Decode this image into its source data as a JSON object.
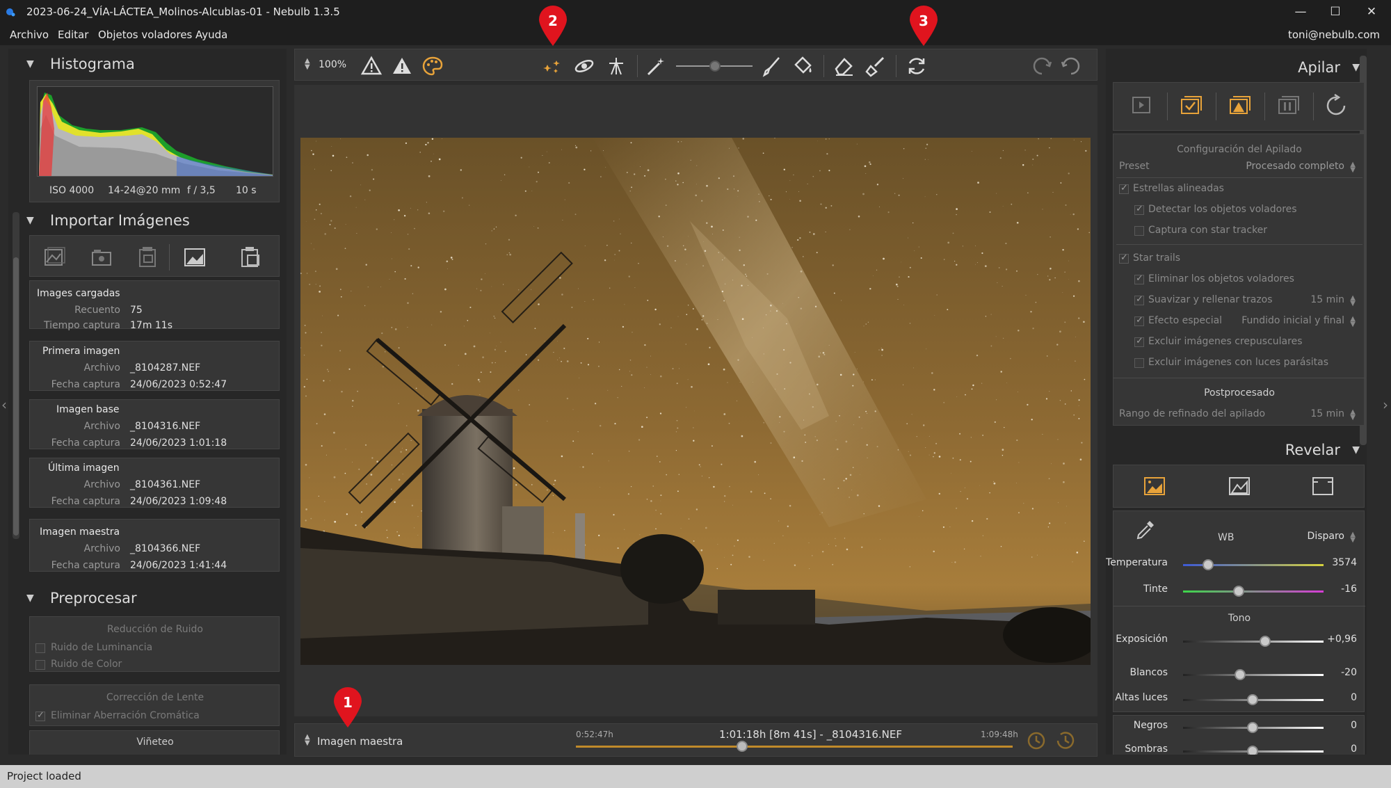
{
  "window": {
    "title": "2023-06-24_VÍA-LÁCTEA_Molinos-Alcublas-01 - Nebulb 1.3.5",
    "minimize": "—",
    "maximize": "☐",
    "close": "✕"
  },
  "menu": {
    "items": [
      "Archivo",
      "Editar",
      "Objetos voladores",
      "Ayuda"
    ],
    "user": "toni@nebulb.com"
  },
  "left": {
    "histogram": {
      "title": "Histograma",
      "iso": "ISO 4000",
      "lens": "14-24@20 mm",
      "aperture": "f / 3,5",
      "exposure": "10 s"
    },
    "import": {
      "title": "Importar Imágenes",
      "loaded": {
        "label": "Images cargadas",
        "count_key": "Recuento",
        "count_val": "75",
        "time_key": "Tiempo captura",
        "time_val": "17m 11s"
      },
      "first": {
        "label": "Primera imagen",
        "file_key": "Archivo",
        "file_val": "_8104287.NEF",
        "date_key": "Fecha captura",
        "date_val": "24/06/2023 0:52:47"
      },
      "base": {
        "label": "Imagen base",
        "file_key": "Archivo",
        "file_val": "_8104316.NEF",
        "date_key": "Fecha captura",
        "date_val": "24/06/2023 1:01:18"
      },
      "last": {
        "label": "Última imagen",
        "file_key": "Archivo",
        "file_val": "_8104361.NEF",
        "date_key": "Fecha captura",
        "date_val": "24/06/2023 1:09:48"
      },
      "master": {
        "label": "Imagen maestra",
        "file_key": "Archivo",
        "file_val": "_8104366.NEF",
        "date_key": "Fecha captura",
        "date_val": "24/06/2023 1:41:44"
      }
    },
    "preprocess": {
      "title": "Preprocesar",
      "noise_title": "Reducción de Ruido",
      "luminance": "Ruido de Luminancia",
      "color": "Ruido de Color",
      "lens_title": "Corrección de Lente",
      "chromatic": "Eliminar Aberración Cromática",
      "vignette": "Viñeteo"
    }
  },
  "toolbar": {
    "zoom": "100%"
  },
  "timeline": {
    "label": "Imagen maestra",
    "start": "0:52:47h",
    "center": "1:01:18h [8m 41s] - _8104316.NEF",
    "end": "1:09:48h",
    "position": 0.38
  },
  "markers": {
    "m1": "1",
    "m2": "2",
    "m3": "3"
  },
  "right": {
    "stack": {
      "title": "Apilar",
      "config_title": "Configuración del Apilado",
      "preset_key": "Preset",
      "preset_val": "Procesado completo",
      "aligned": "Estrellas alineadas",
      "detect": "Detectar los objetos voladores",
      "tracker": "Captura con star tracker",
      "trails": "Star trails",
      "remove": "Eliminar los objetos voladores",
      "smooth": "Suavizar y rellenar trazos",
      "smooth_val": "15 min",
      "effect": "Efecto especial",
      "effect_val": "Fundido inicial y final",
      "twilight": "Excluir imágenes crepusculares",
      "parasitic": "Excluir imágenes con luces parásitas",
      "post_title": "Postprocesado",
      "refine": "Rango de refinado del apilado",
      "refine_val": "15 min"
    },
    "develop": {
      "title": "Revelar",
      "wb": "WB",
      "wb_mode": "Disparo",
      "temperature": "Temperatura",
      "temperature_val": "3574",
      "tint": "Tinte",
      "tint_val": "-16",
      "tone_title": "Tono",
      "exposure": "Exposición",
      "exposure_val": "+0,96",
      "whites": "Blancos",
      "whites_val": "-20",
      "highlights": "Altas luces",
      "highlights_val": "0",
      "blacks": "Negros",
      "blacks_val": "0",
      "shadows": "Sombras",
      "shadows_val": "0"
    }
  },
  "status": "Project loaded",
  "colors": {
    "accent": "#e8a33a",
    "marker": "#e0141e",
    "panel": "#363636"
  }
}
